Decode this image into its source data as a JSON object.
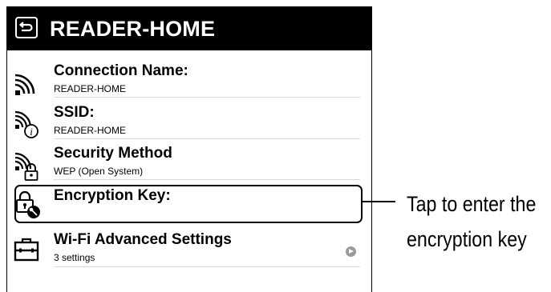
{
  "header": {
    "title": "READER-HOME"
  },
  "rows": [
    {
      "label": "Connection Name:",
      "value": "READER-HOME",
      "icon": "wifi-signal-icon"
    },
    {
      "label": "SSID:",
      "value": "READER-HOME",
      "icon": "wifi-info-icon"
    },
    {
      "label": "Security Method",
      "value": "WEP (Open System)",
      "icon": "wifi-lock-icon"
    },
    {
      "label": "Encryption Key:",
      "value": "",
      "icon": "key-lock-icon"
    },
    {
      "label": "Wi-Fi Advanced Settings",
      "value": "3 settings",
      "icon": "toolbox-icon"
    }
  ],
  "callout": {
    "line1": "Tap to enter the",
    "line2": "encryption key"
  }
}
